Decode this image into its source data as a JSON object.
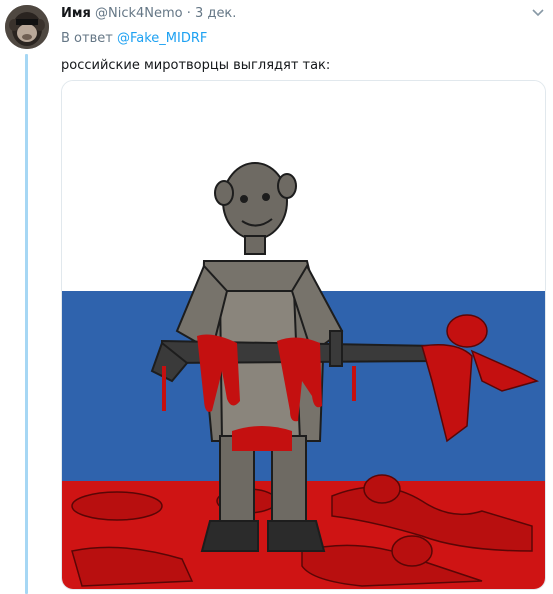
{
  "tweet": {
    "author_name": "Имя",
    "handle": "@Nick4Nemo",
    "separator": "·",
    "date": "3 дек.",
    "reply_prefix": "В ответ",
    "reply_to": "@Fake_MIDRF",
    "text": "российские миротворцы выглядят так:"
  },
  "media": {
    "type": "image",
    "flag_colors": {
      "white": "#ffffff",
      "blue": "#2f63ad",
      "red": "#cf1414"
    }
  },
  "icons": {
    "avatar": "monkey-avatar",
    "more": "chevron-down-icon"
  },
  "colors": {
    "link": "#1da1f2",
    "muted": "#657786",
    "thread_line": "#a6d7f4"
  }
}
